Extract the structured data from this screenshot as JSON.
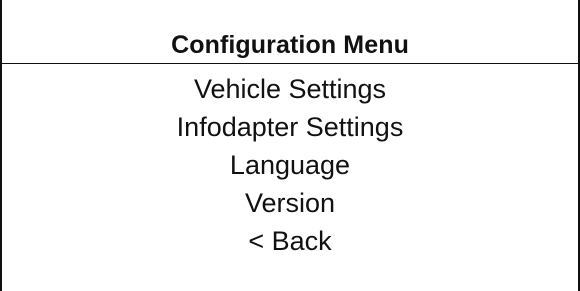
{
  "menu": {
    "title": "Configuration Menu",
    "items": [
      {
        "label": "Vehicle Settings"
      },
      {
        "label": "Infodapter Settings"
      },
      {
        "label": "Language"
      },
      {
        "label": "Version"
      },
      {
        "label": "< Back"
      }
    ]
  }
}
